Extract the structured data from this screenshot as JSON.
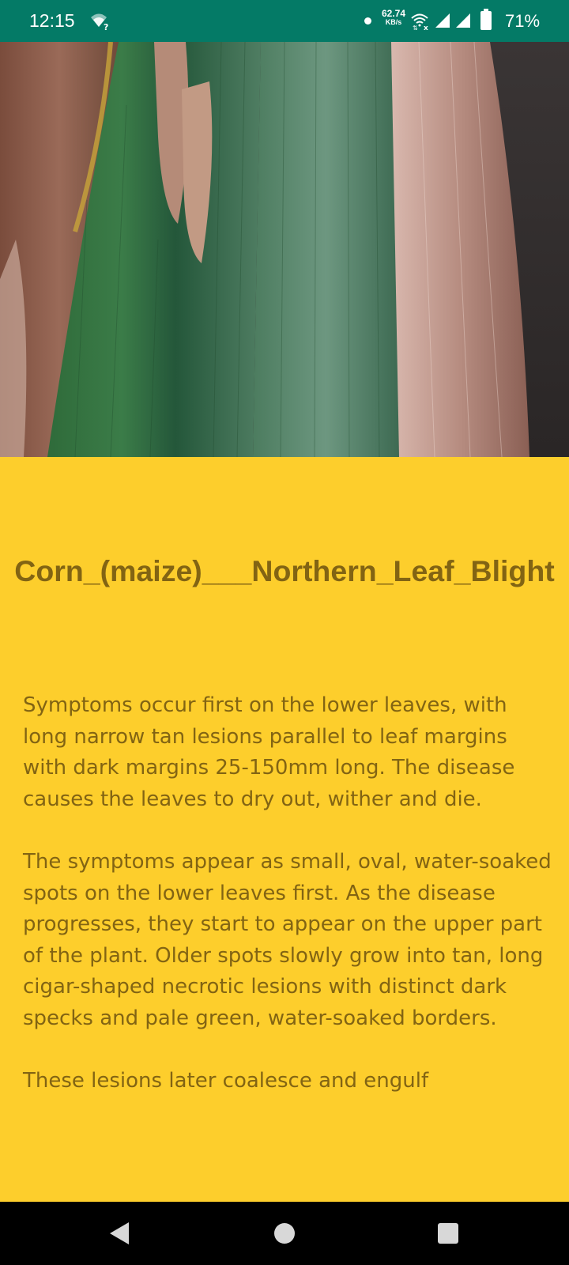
{
  "status_bar": {
    "time": "12:15",
    "network_speed_value": "62.74",
    "network_speed_unit": "KB/s",
    "battery_percent": "71%",
    "background_color": "#047A66",
    "icons": [
      "wifi-question-icon",
      "notification-dot-icon",
      "wifi-off-icon",
      "signal-icon",
      "signal-icon",
      "battery-icon"
    ]
  },
  "hero": {
    "image": "corn-leaf-photo"
  },
  "disease": {
    "title": "Corn_(maize)___Northern_Leaf_Blight",
    "paragraphs": [
      "Symptoms occur first on the lower leaves, with long narrow tan lesions parallel to leaf margins with dark margins 25-150mm long. The disease causes the leaves to dry out, wither and die.",
      "The symptoms appear as small, oval, water-soaked spots on the lower leaves first. As the disease progresses, they start to appear on the upper part of the plant. Older spots slowly grow into tan, long cigar-shaped necrotic lesions with distinct dark specks and pale green, water-soaked borders.",
      "These lesions later coalesce and engulf"
    ]
  },
  "nav_bar": {
    "icons": [
      "back-icon",
      "home-icon",
      "recents-icon"
    ]
  },
  "colors": {
    "accent": "#FDCE2C",
    "text": "#826413",
    "status_bar": "#047A66"
  }
}
